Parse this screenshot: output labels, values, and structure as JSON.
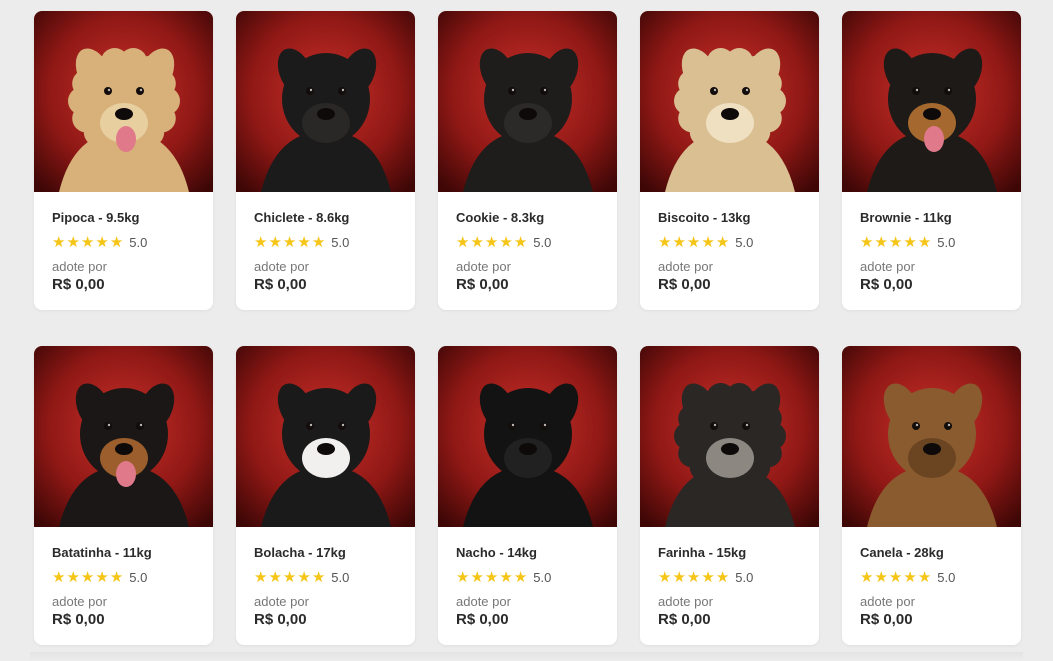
{
  "colors": {
    "background": "#ececec",
    "card": "#ffffff",
    "star": "#f5c518",
    "photo_backdrop": "#b3201c"
  },
  "dogs": [
    {
      "name": "Pipoca - 9.5kg",
      "rating": "5.0",
      "adopt_label": "adote por",
      "price": "R$ 0,00",
      "fur": "#d7b07a",
      "muzzle": "#e8cfa0",
      "scruffy": true,
      "tongue": true
    },
    {
      "name": "Chiclete - 8.6kg",
      "rating": "5.0",
      "adopt_label": "adote por",
      "price": "R$ 0,00",
      "fur": "#1c1b1b",
      "muzzle": "#2a2827",
      "scruffy": false,
      "tongue": false
    },
    {
      "name": "Cookie - 8.3kg",
      "rating": "5.0",
      "adopt_label": "adote por",
      "price": "R$ 0,00",
      "fur": "#1e1d1c",
      "muzzle": "#2b2a29",
      "scruffy": false,
      "tongue": false
    },
    {
      "name": "Biscoito - 13kg",
      "rating": "5.0",
      "adopt_label": "adote por",
      "price": "R$ 0,00",
      "fur": "#d9bf92",
      "muzzle": "#efe0c2",
      "scruffy": true,
      "tongue": false
    },
    {
      "name": "Brownie - 11kg",
      "rating": "5.0",
      "adopt_label": "adote por",
      "price": "R$ 0,00",
      "fur": "#1d1a18",
      "muzzle": "#a5692f",
      "scruffy": false,
      "tongue": true
    },
    {
      "name": "Batatinha - 11kg",
      "rating": "5.0",
      "adopt_label": "adote por",
      "price": "R$ 0,00",
      "fur": "#1a1716",
      "muzzle": "#9b5e2c",
      "scruffy": false,
      "tongue": true
    },
    {
      "name": "Bolacha - 17kg",
      "rating": "5.0",
      "adopt_label": "adote por",
      "price": "R$ 0,00",
      "fur": "#1b1a1a",
      "muzzle": "#f2f0ee",
      "scruffy": false,
      "tongue": false
    },
    {
      "name": "Nacho - 14kg",
      "rating": "5.0",
      "adopt_label": "adote por",
      "price": "R$ 0,00",
      "fur": "#141313",
      "muzzle": "#222121",
      "scruffy": false,
      "tongue": false
    },
    {
      "name": "Farinha - 15kg",
      "rating": "5.0",
      "adopt_label": "adote por",
      "price": "R$ 0,00",
      "fur": "#2a2725",
      "muzzle": "#8d8782",
      "scruffy": true,
      "tongue": false
    },
    {
      "name": "Canela - 28kg",
      "rating": "5.0",
      "adopt_label": "adote por",
      "price": "R$ 0,00",
      "fur": "#8a5b2e",
      "muzzle": "#6b4422",
      "scruffy": false,
      "tongue": false
    }
  ]
}
